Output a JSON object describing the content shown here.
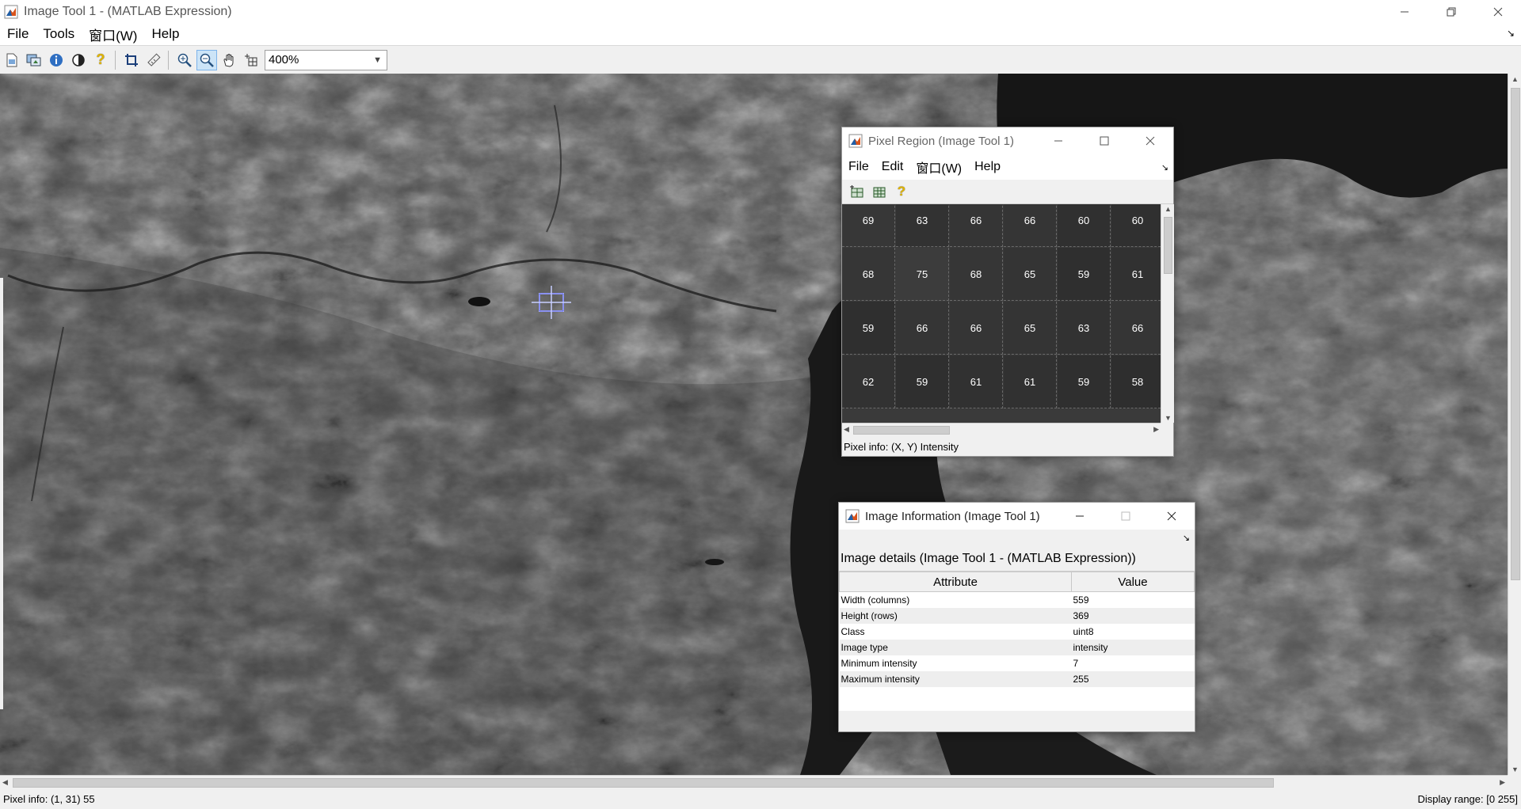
{
  "window": {
    "title": "Image Tool 1 - (MATLAB Expression)",
    "menu": [
      "File",
      "Tools",
      "窗口(W)",
      "Help"
    ]
  },
  "toolbar": {
    "icons": [
      "new-figure-icon",
      "export-icon",
      "image-info-icon",
      "contrast-icon",
      "help-icon",
      "crop-icon",
      "measure-distance-icon",
      "zoom-in-icon",
      "zoom-out-icon",
      "pan-hand-icon",
      "pixel-region-icon"
    ],
    "zoom_value": "400%"
  },
  "status": {
    "pixel_info": "Pixel info: (1, 31)  55",
    "display_range": "Display range: [0 255]"
  },
  "pixel_region": {
    "title": "Pixel Region (Image Tool 1)",
    "menu": [
      "File",
      "Edit",
      "窗口(W)",
      "Help"
    ],
    "rows": [
      [
        "69",
        "63",
        "66",
        "66",
        "60",
        "60"
      ],
      [
        "68",
        "75",
        "68",
        "65",
        "59",
        "61"
      ],
      [
        "59",
        "66",
        "66",
        "65",
        "63",
        "66"
      ],
      [
        "62",
        "59",
        "61",
        "61",
        "59",
        "58"
      ]
    ],
    "status": "Pixel info: (X, Y)  Intensity"
  },
  "image_info": {
    "title": "Image Information (Image Tool 1)",
    "heading": "Image details  (Image Tool 1 - (MATLAB Expression))",
    "columns": [
      "Attribute",
      "Value"
    ],
    "rows": [
      {
        "attr": "Width (columns)",
        "value": "559"
      },
      {
        "attr": "Height (rows)",
        "value": "369"
      },
      {
        "attr": "Class",
        "value": "uint8"
      },
      {
        "attr": "Image type",
        "value": "intensity"
      },
      {
        "attr": "Minimum intensity",
        "value": "7"
      },
      {
        "attr": "Maximum intensity",
        "value": "255"
      }
    ]
  },
  "colors": {
    "image_bg": "#555555",
    "water": "#1b1b1b",
    "accent_selection": "#cce4f7"
  }
}
